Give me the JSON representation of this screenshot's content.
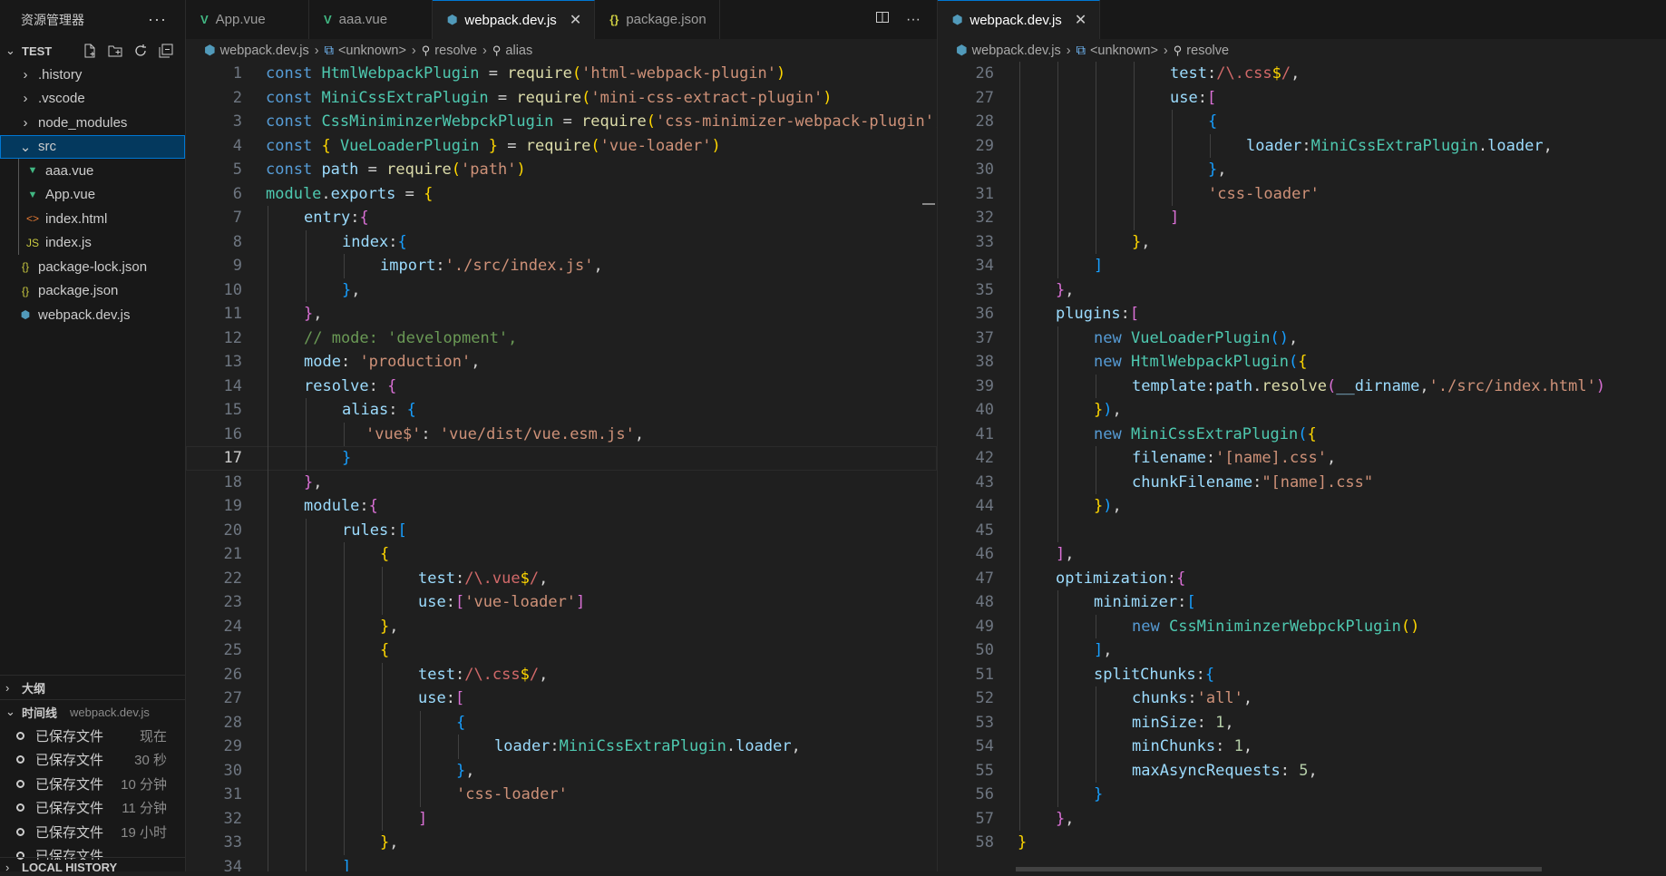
{
  "sidebar": {
    "title": "资源管理器",
    "more": "···",
    "workspace": "TEST",
    "items": [
      {
        "label": ".history",
        "kind": "folder",
        "icon": "chevron-right"
      },
      {
        "label": ".vscode",
        "kind": "folder",
        "icon": "chevron-right"
      },
      {
        "label": "node_modules",
        "kind": "folder",
        "icon": "chevron-right"
      },
      {
        "label": "src",
        "kind": "folder-open",
        "icon": "chevron-down"
      },
      {
        "label": "aaa.vue",
        "kind": "vue"
      },
      {
        "label": "App.vue",
        "kind": "vue"
      },
      {
        "label": "index.html",
        "kind": "html"
      },
      {
        "label": "index.js",
        "kind": "js"
      },
      {
        "label": "package-lock.json",
        "kind": "json"
      },
      {
        "label": "package.json",
        "kind": "json"
      },
      {
        "label": "webpack.dev.js",
        "kind": "webpack"
      }
    ],
    "outline_label": "大纲",
    "timeline_label": "时间线",
    "timeline_file": "webpack.dev.js",
    "timeline": [
      {
        "label": "已保存文件",
        "time": "现在"
      },
      {
        "label": "已保存文件",
        "time": "30 秒"
      },
      {
        "label": "已保存文件",
        "time": "10 分钟"
      },
      {
        "label": "已保存文件",
        "time": "11 分钟"
      },
      {
        "label": "已保存文件",
        "time": "19 小时"
      },
      {
        "label": "已保存文件",
        "time": ""
      }
    ],
    "local_history_label": "LOCAL HISTORY"
  },
  "left_editor": {
    "tabs": [
      {
        "label": "App.vue",
        "icon": "V",
        "active": false
      },
      {
        "label": "aaa.vue",
        "icon": "V",
        "active": false
      },
      {
        "label": "webpack.dev.js",
        "icon": "⬢",
        "active": true,
        "close": "✕"
      },
      {
        "label": "package.json",
        "icon": "{}",
        "active": false
      }
    ],
    "breadcrumb": [
      "webpack.dev.js",
      "<unknown>",
      "resolve",
      "alias"
    ],
    "current_line": 17
  },
  "right_editor": {
    "tabs": [
      {
        "label": "webpack.dev.js",
        "icon": "⬢",
        "active": true,
        "close": "✕"
      }
    ],
    "breadcrumb": [
      "webpack.dev.js",
      "<unknown>",
      "resolve"
    ]
  },
  "colors": {
    "keyword": "#569cd6",
    "variable": "#9cdcfe",
    "class": "#4ec9b0",
    "string": "#ce9178",
    "function": "#dcdcaa",
    "bracket1": "#ffd700",
    "bracket2": "#da70d6",
    "bracket3": "#179fff",
    "comment": "#6a9955",
    "number": "#b5cea8",
    "accent": "#0078d4"
  }
}
